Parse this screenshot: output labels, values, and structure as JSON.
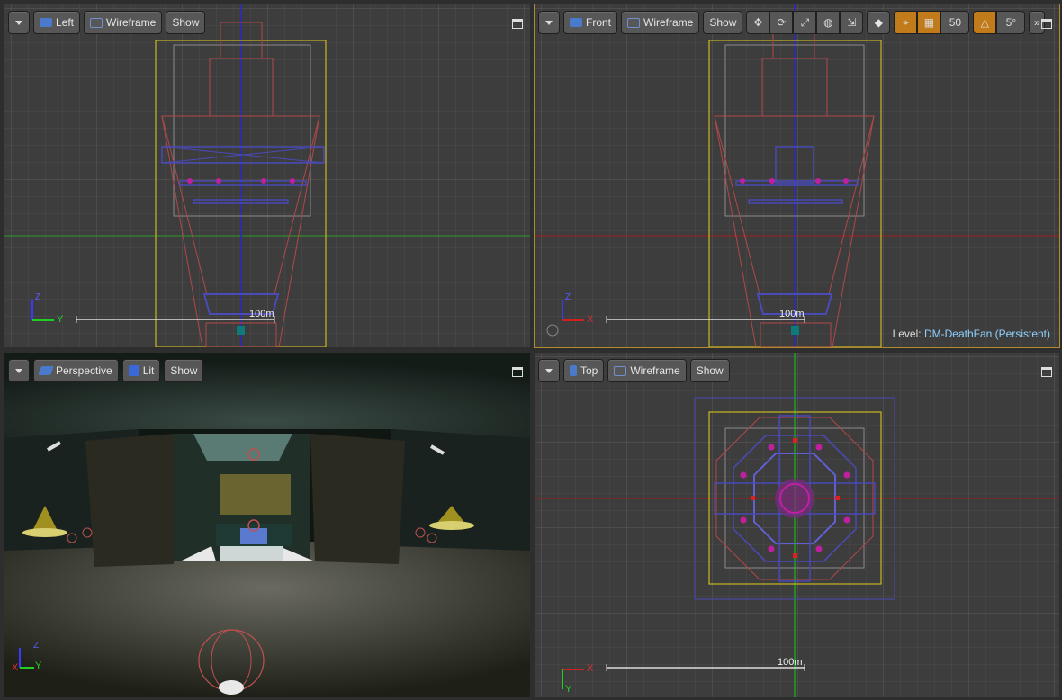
{
  "viewports": {
    "left": {
      "view_label": "Left",
      "mode_label": "Wireframe",
      "show_label": "Show",
      "scale_label": "100m",
      "axis_labels": [
        "Z",
        "Y"
      ]
    },
    "front": {
      "view_label": "Front",
      "mode_label": "Wireframe",
      "show_label": "Show",
      "scale_label": "100m",
      "axis_labels": [
        "Z",
        "X"
      ],
      "grid_size": "50",
      "rotation_snap": "5°",
      "level_prefix": "Level:",
      "level_name": "DM-DeathFan (Persistent)"
    },
    "perspective": {
      "view_label": "Perspective",
      "mode_label": "Lit",
      "show_label": "Show",
      "axis_labels": [
        "Z",
        "X",
        "Y"
      ]
    },
    "top": {
      "view_label": "Top",
      "mode_label": "Wireframe",
      "show_label": "Show",
      "scale_label": "100m",
      "axis_labels": [
        "X",
        "Y"
      ]
    }
  },
  "toolbar_icons": [
    "translate-icon",
    "rotate-icon",
    "scale-icon",
    "world-icon",
    "surface-snap-icon",
    "grid-snap-icon",
    "rotation-snap-icon",
    "more-icon"
  ],
  "colors": {
    "active_border": "#b08a2e",
    "accent_orange": "#c27b1a",
    "level_name": "#8fd0ff"
  }
}
